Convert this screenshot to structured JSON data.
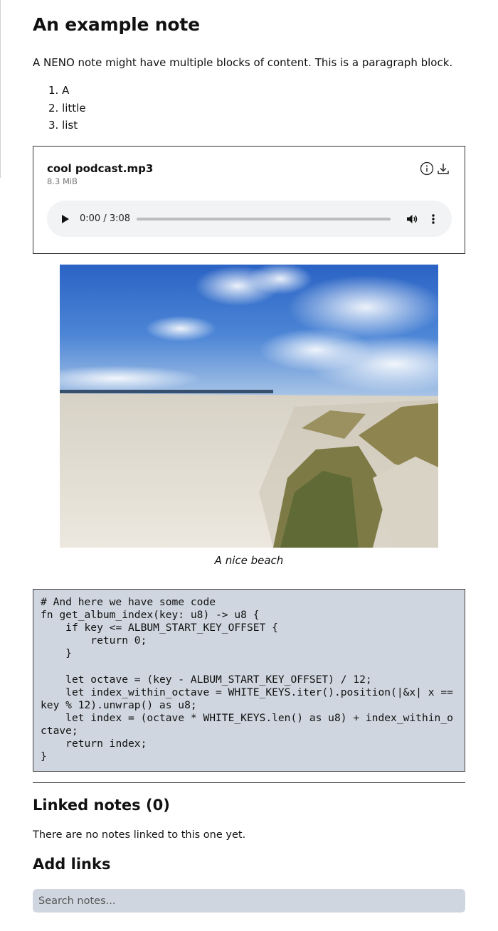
{
  "note": {
    "title": "An example note",
    "paragraph": "A NENO note might have multiple blocks of content. This is a paragraph block.",
    "list_items": [
      "1. A",
      "2. little",
      "3. list"
    ]
  },
  "audio": {
    "file_name": "cool podcast.mp3",
    "file_size": "8.3 MiB",
    "time_display": "0:00 / 3:08",
    "progress": 0,
    "icons": {
      "info": "info-icon",
      "download": "download-icon",
      "play": "play-icon",
      "volume": "volume-icon",
      "more": "more-vertical-icon"
    }
  },
  "image": {
    "caption": "A nice beach"
  },
  "code": "# And here we have some code\nfn get_album_index(key: u8) -> u8 {\n    if key <= ALBUM_START_KEY_OFFSET {\n        return 0;\n    }\n\n    let octave = (key - ALBUM_START_KEY_OFFSET) / 12;\n    let index_within_octave = WHITE_KEYS.iter().position(|&x| x == key % 12).unwrap() as u8;\n    let index = (octave * WHITE_KEYS.len() as u8) + index_within_octave;\n    return index;\n}",
  "linked_notes": {
    "heading": "Linked notes (0)",
    "empty_text": "There are no notes linked to this one yet."
  },
  "add_links": {
    "heading": "Add links",
    "search_placeholder": "Search notes..."
  },
  "colors": {
    "code_bg": "#cfd6df",
    "search_bg": "#cfd6df",
    "player_bg": "#f1f3f4"
  }
}
